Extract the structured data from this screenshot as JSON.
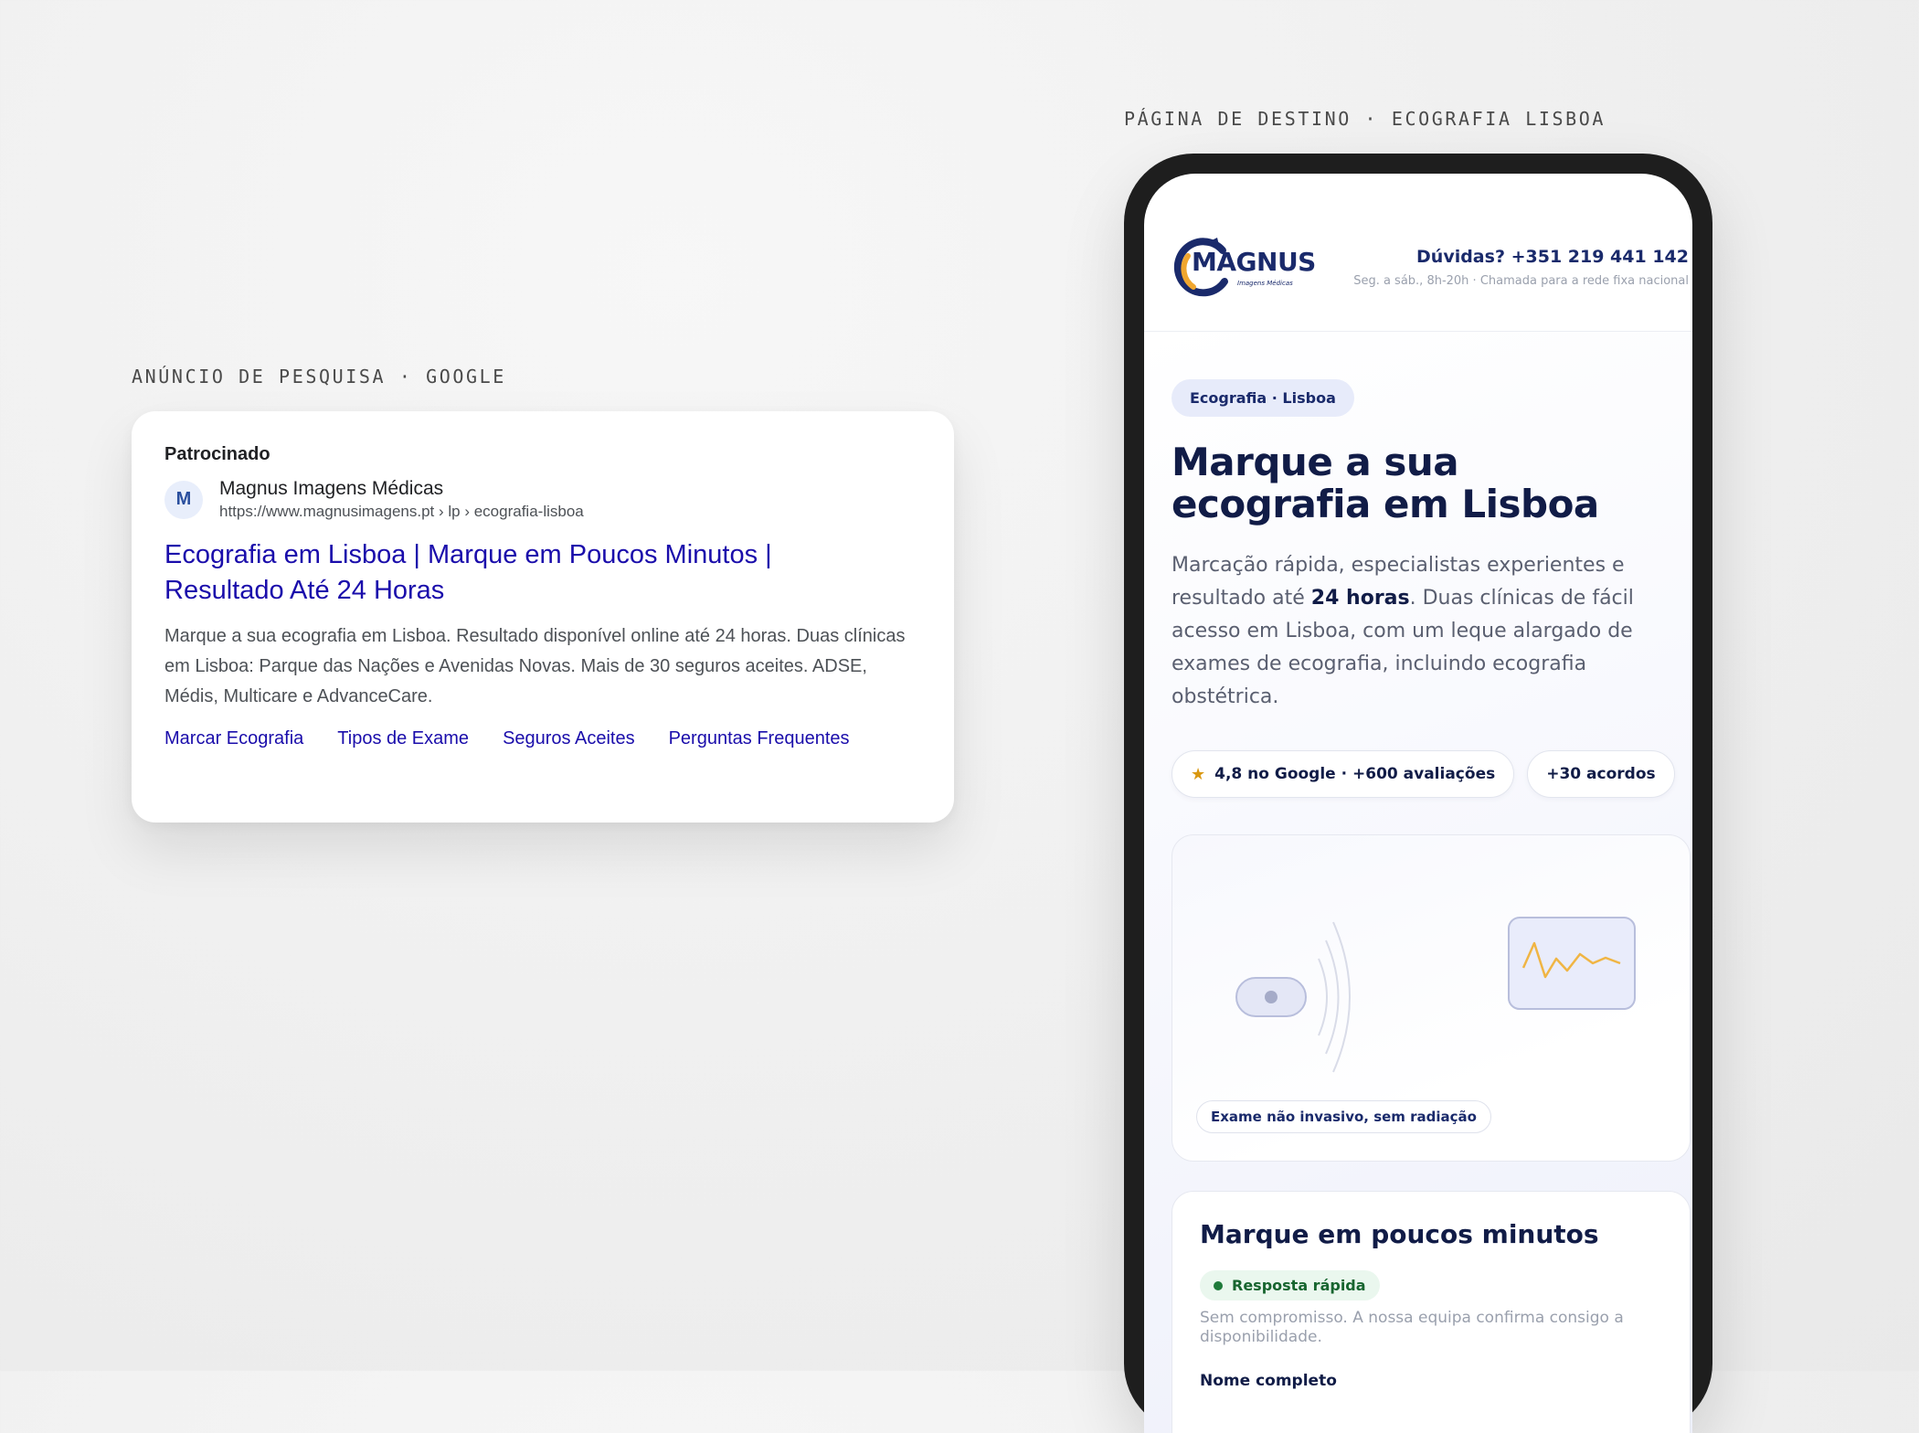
{
  "captions": {
    "ad": "ANÚNCIO DE PESQUISA · GOOGLE",
    "landing": "PÁGINA DE DESTINO · ECOGRAFIA LISBOA"
  },
  "ad": {
    "sponsored": "Patrocinado",
    "favicon_letter": "M",
    "advertiser": "Magnus Imagens Médicas",
    "url": "https://www.magnusimagens.pt › lp › ecografia-lisboa",
    "headline": "Ecografia em Lisboa | Marque em Poucos Minutos | Resultado Até 24 Horas",
    "description": "Marque a sua ecografia em Lisboa. Resultado disponível online até 24 horas. Duas clínicas em Lisboa: Parque das Nações e Avenidas Novas. Mais de 30 seguros aceites. ADSE, Médis, Multicare e AdvanceCare.",
    "sitelinks": [
      "Marcar Ecografia",
      "Tipos de Exame",
      "Seguros Aceites",
      "Perguntas Frequentes"
    ]
  },
  "landing": {
    "logo_word": "MAGNUS",
    "logo_sub": "Imagens Médicas",
    "contact_phone": "Dúvidas? +351 219 441 142",
    "contact_hours": "Seg. a sáb., 8h-20h · Chamada para a rede fixa nacional",
    "tag": "Ecografia · Lisboa",
    "title": "Marque a sua ecografia em Lisboa",
    "text_before": "Marcação rápida, especialistas experientes e resultado até ",
    "text_bold": "24 horas",
    "text_after": ". Duas clínicas de fácil acesso em Lisboa, com um leque alargado de exames de ecografia, incluindo ecografia obstétrica.",
    "badge_rating": "4,8 no Google · +600 avaliações",
    "badge_agreements": "+30 acordos",
    "visual_chip": "Exame não invasivo, sem radiação",
    "form_title": "Marque em poucos minutos",
    "form_pill": "Resposta rápida",
    "form_note": "Sem compromisso. A nossa equipa confirma consigo a disponibilidade.",
    "field_name_label": "Nome completo"
  },
  "colors": {
    "ad_link": "#1a0dab",
    "brand_navy": "#111c47",
    "brand_accent": "#f0a62f",
    "star": "#d9970f",
    "success": "#1f7a3a"
  },
  "icons": {
    "star": "star-icon",
    "favicon": "favicon-m-icon",
    "probe": "ultrasound-probe-icon",
    "monitor": "monitor-waveform-icon"
  }
}
